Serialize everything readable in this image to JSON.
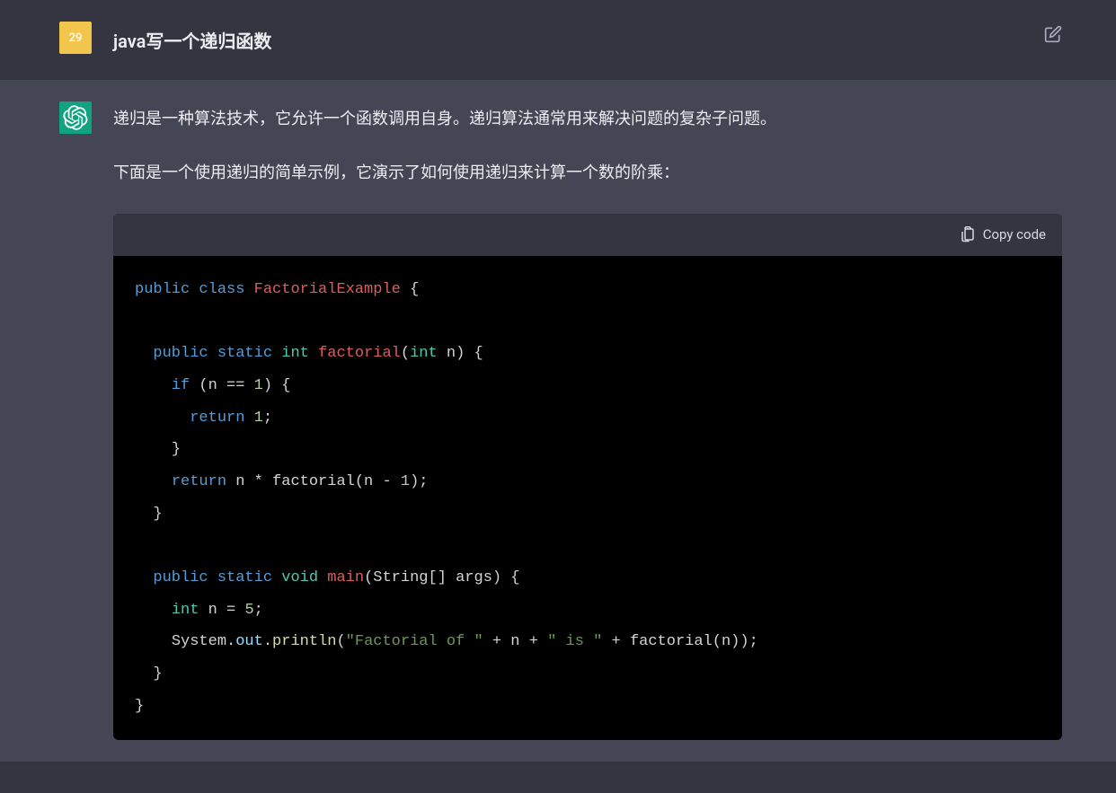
{
  "user": {
    "avatar_text": "29",
    "message": "java写一个递归函数"
  },
  "assistant": {
    "para1": "递归是一种算法技术，它允许一个函数调用自身。递归算法通常用来解决问题的复杂子问题。",
    "para2": "下面是一个使用递归的简单示例，它演示了如何使用递归来计算一个数的阶乘：",
    "copy_label": "Copy code",
    "code": {
      "class_decl": {
        "kw_public": "public",
        "kw_class": "class",
        "name": "FactorialExample"
      },
      "method1": {
        "kw_public": "public",
        "kw_static": "static",
        "ret_type": "int",
        "name": "factorial",
        "param_type": "int",
        "param_name": "n",
        "if_kw": "if",
        "cond_l": "(n == ",
        "cond_num": "1",
        "cond_r": ")",
        "ret1_kw": "return",
        "ret1_num": "1",
        "ret2_kw": "return",
        "ret2_expr_l": "n * factorial(n - ",
        "ret2_num": "1",
        "ret2_expr_r": ")"
      },
      "method2": {
        "kw_public": "public",
        "kw_static": "static",
        "ret_type": "void",
        "name": "main",
        "param": "String[] args",
        "decl_type": "int",
        "decl_name": "n",
        "decl_num": "5",
        "sys": "System",
        "out": "out",
        "println": "println",
        "str1": "\"Factorial of \"",
        "plus1": " + n + ",
        "str2": "\" is \"",
        "plus2": " + factorial(n))"
      }
    }
  }
}
